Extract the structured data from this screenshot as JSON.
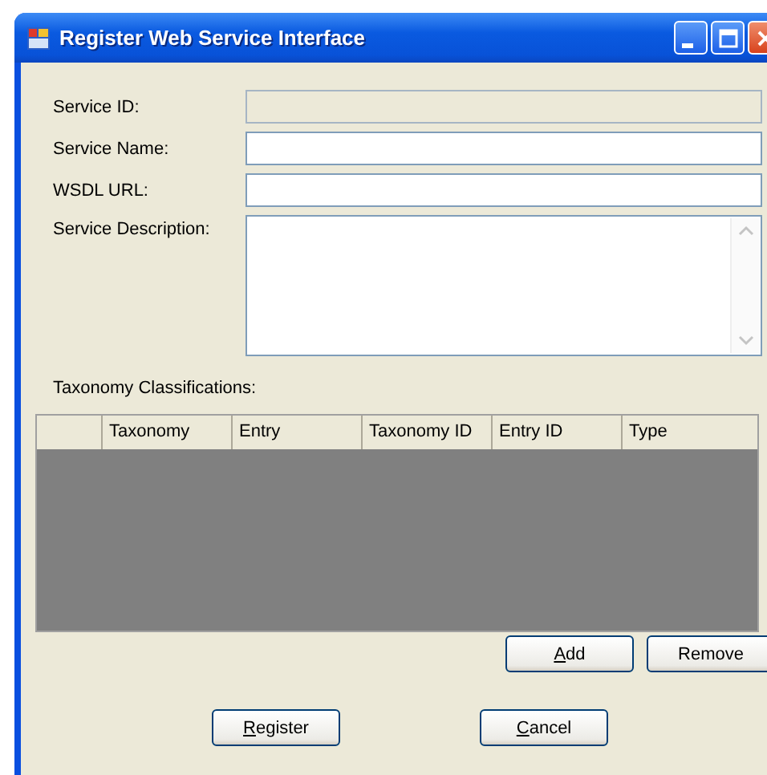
{
  "window": {
    "title": "Register Web Service Interface"
  },
  "fields": [
    {
      "label": "Service ID:",
      "kind": "text",
      "disabled": true
    },
    {
      "label": "Service Name:",
      "kind": "text",
      "disabled": false
    },
    {
      "label": "WSDL URL:",
      "kind": "text",
      "disabled": false
    },
    {
      "label": "Service Description:",
      "kind": "multiline",
      "disabled": false
    }
  ],
  "taxonomy": {
    "label": "Taxonomy Classifications:",
    "columns": [
      "Taxonomy",
      "Entry",
      "Taxonomy ID",
      "Entry ID",
      "Type"
    ]
  },
  "grid_buttons": [
    {
      "label": "Add",
      "underline_first": true
    },
    {
      "label": "Remove",
      "underline_first": false
    }
  ],
  "dialog_buttons": [
    {
      "label": "Register",
      "underline_first": true
    },
    {
      "label": "Cancel",
      "underline_first": true
    }
  ]
}
